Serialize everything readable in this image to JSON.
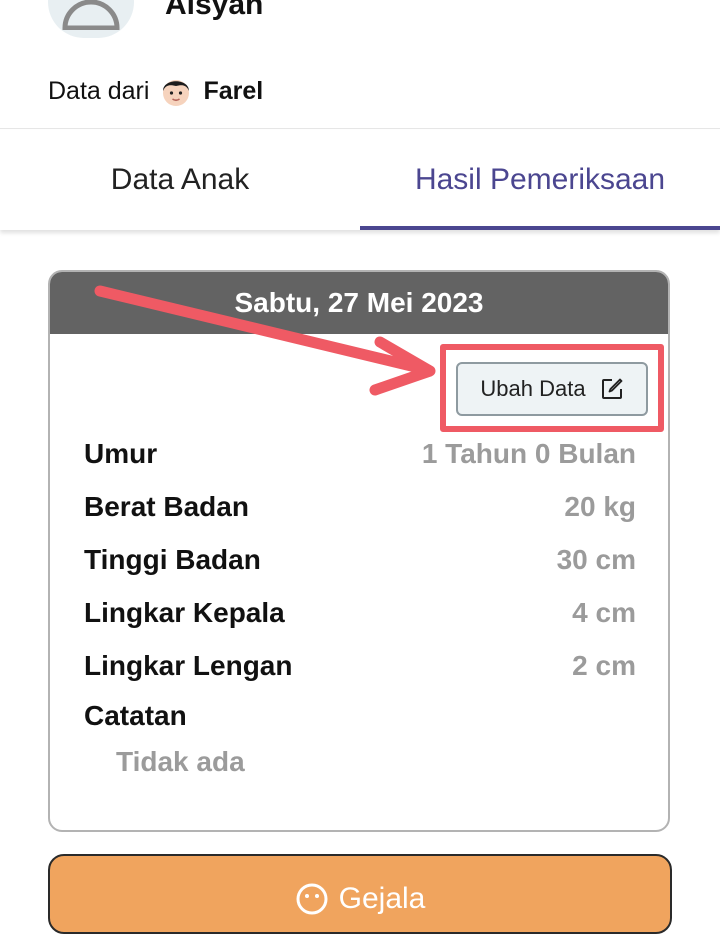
{
  "header": {
    "child_name": "Aisyah",
    "data_from_label": "Data dari",
    "owner_name": "Farel"
  },
  "tabs": [
    {
      "label": "Data Anak",
      "active": false
    },
    {
      "label": "Hasil Pemeriksaan",
      "active": true
    }
  ],
  "record": {
    "date": "Sabtu, 27 Mei 2023",
    "edit_label": "Ubah Data",
    "rows": [
      {
        "label": "Umur",
        "value": "1 Tahun 0 Bulan"
      },
      {
        "label": "Berat Badan",
        "value": "20 kg"
      },
      {
        "label": "Tinggi Badan",
        "value": "30 cm"
      },
      {
        "label": "Lingkar Kepala",
        "value": "4 cm"
      },
      {
        "label": "Lingkar Lengan",
        "value": "2 cm"
      }
    ],
    "notes_label": "Catatan",
    "notes_value": "Tidak ada"
  },
  "symptom_button": {
    "label": "Gejala"
  },
  "colors": {
    "accent": "#4b4690",
    "card_header": "#636363",
    "annotation": "#ef5a64",
    "symptom_button": "#f0a45e"
  }
}
